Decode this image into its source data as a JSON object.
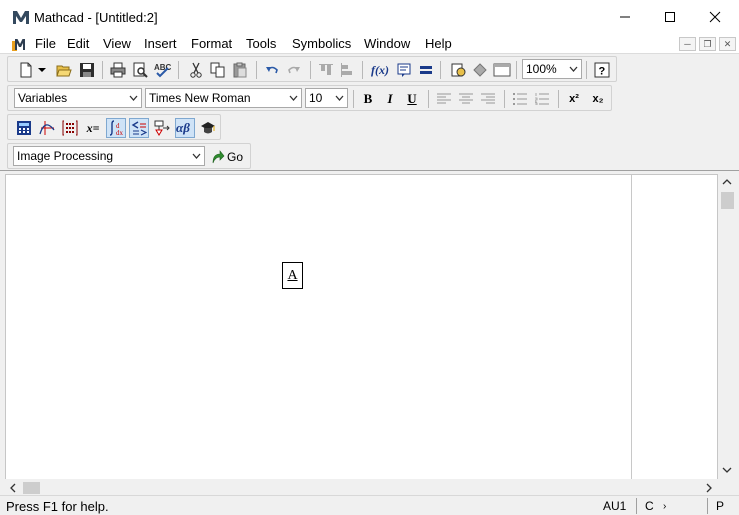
{
  "window": {
    "title": "Mathcad - [Untitled:2]",
    "app_icon": "mathcad-logo-icon",
    "controls": [
      "minimize-icon",
      "maximize-icon",
      "close-icon"
    ]
  },
  "menubar": {
    "items": [
      "File",
      "Edit",
      "View",
      "Insert",
      "Format",
      "Tools",
      "Symbolics",
      "Window",
      "Help"
    ],
    "mdi_controls": [
      "minimize-icon",
      "restore-icon",
      "close-icon"
    ]
  },
  "standard_toolbar": {
    "zoom": "100%",
    "buttons": [
      "new-icon",
      "open-icon",
      "save-icon",
      "print-icon",
      "print-preview-icon",
      "spell-check-icon",
      "cut-icon",
      "copy-icon",
      "paste-icon",
      "undo-icon",
      "redo-icon",
      "align-across-icon",
      "align-down-icon",
      "insert-function-icon",
      "insert-unit-icon",
      "calculate-icon",
      "resource-center-icon",
      "component-icon",
      "insert-region-icon",
      "help-icon"
    ]
  },
  "formatting_toolbar": {
    "style": "Variables",
    "font": "Times New Roman",
    "size": "10",
    "bold": "B",
    "italic": "I",
    "underline": "U",
    "superscript": "x²",
    "subscript": "x₂"
  },
  "math_toolbar": {
    "buttons": [
      "calculator-icon",
      "graph-icon",
      "matrix-icon",
      "evaluation-icon",
      "calculus-icon",
      "boolean-icon",
      "programming-icon",
      "greek-icon",
      "symbolic-icon"
    ],
    "eval_label": "x="
  },
  "resources_toolbar": {
    "selected": "Image Processing",
    "go_label": "Go"
  },
  "document": {
    "text_region": "A"
  },
  "statusbar": {
    "help_text": "Press F1 for help.",
    "auto_mode": "AU1",
    "cell1": "C",
    "cell2": "P"
  },
  "colors": {
    "accent_blue": "#2b5aa8",
    "pressed_bg": "#cfe3f7"
  }
}
